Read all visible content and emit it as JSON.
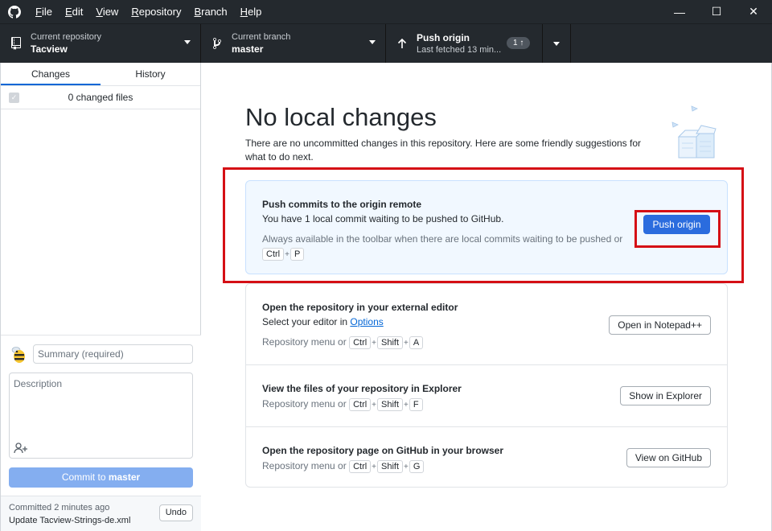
{
  "titlebar": {
    "menu": [
      {
        "label": "File",
        "mnemonic": "F",
        "rest": "ile"
      },
      {
        "label": "Edit",
        "mnemonic": "E",
        "rest": "dit"
      },
      {
        "label": "View",
        "mnemonic": "V",
        "rest": "iew"
      },
      {
        "label": "Repository",
        "mnemonic": "R",
        "rest": "epository"
      },
      {
        "label": "Branch",
        "mnemonic": "B",
        "rest": "ranch"
      },
      {
        "label": "Help",
        "mnemonic": "H",
        "rest": "elp"
      }
    ],
    "controls": {
      "minimize": "—",
      "maximize": "☐",
      "close": "✕"
    }
  },
  "toolbar": {
    "repo": {
      "label": "Current repository",
      "value": "Tacview"
    },
    "branch": {
      "label": "Current branch",
      "value": "master"
    },
    "push": {
      "label": "Push origin",
      "sub": "Last fetched 13 min...",
      "badge": "1 ↑"
    }
  },
  "sidebar": {
    "tabs": [
      {
        "label": "Changes"
      },
      {
        "label": "History"
      }
    ],
    "changed_files": "0 changed files",
    "summary_placeholder": "Summary (required)",
    "description_placeholder": "Description",
    "commit_button": {
      "prefix": "Commit to ",
      "branch": "master"
    },
    "last_commit": {
      "time": "Committed 2 minutes ago",
      "message": "Update Tacview-Strings-de.xml",
      "undo": "Undo"
    }
  },
  "main": {
    "title": "No local changes",
    "subtitle": "There are no uncommitted changes in this repository. Here are some friendly suggestions for what to do next.",
    "push_card": {
      "title": "Push commits to the origin remote",
      "line": "You have 1 local commit waiting to be pushed to GitHub.",
      "muted": "Always available in the toolbar when there are local commits waiting to be pushed or",
      "keys": [
        "Ctrl",
        "P"
      ],
      "button": "Push origin"
    },
    "editor_card": {
      "title": "Open the repository in your external editor",
      "line_prefix": "Select your editor in ",
      "line_link": "Options",
      "muted": "Repository menu or",
      "keys": [
        "Ctrl",
        "Shift",
        "A"
      ],
      "button": "Open in Notepad++"
    },
    "explorer_card": {
      "title": "View the files of your repository in Explorer",
      "muted": "Repository menu or",
      "keys": [
        "Ctrl",
        "Shift",
        "F"
      ],
      "button": "Show in Explorer"
    },
    "github_card": {
      "title": "Open the repository page on GitHub in your browser",
      "muted": "Repository menu or",
      "keys": [
        "Ctrl",
        "Shift",
        "G"
      ],
      "button": "View on GitHub"
    },
    "plus": "+"
  },
  "colors": {
    "accent": "#2b6cde",
    "highlight": "#d50f15",
    "titlebar": "#24292e"
  }
}
